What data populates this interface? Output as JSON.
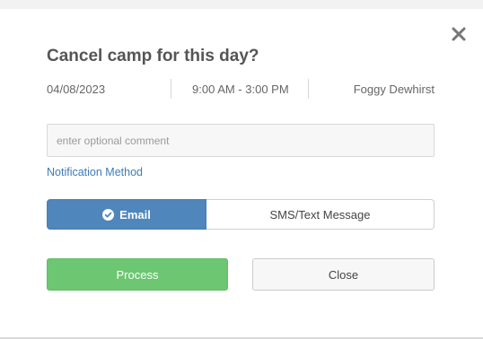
{
  "dialog": {
    "title": "Cancel camp for this day?",
    "date": "04/08/2023",
    "time": "9:00 AM - 3:00 PM",
    "person": "Foggy Dewhirst",
    "close_icon": "close-icon"
  },
  "comment": {
    "placeholder": "enter optional comment",
    "value": ""
  },
  "notification": {
    "label": "Notification Method",
    "options": [
      {
        "label": "Email",
        "selected": true,
        "icon": "check-circle-icon"
      },
      {
        "label": "SMS/Text Message",
        "selected": false
      }
    ]
  },
  "actions": {
    "process_label": "Process",
    "close_label": "Close"
  },
  "colors": {
    "accent_blue": "#4f86bc",
    "process_green": "#6dc672",
    "link_blue": "#3e7cb5"
  }
}
